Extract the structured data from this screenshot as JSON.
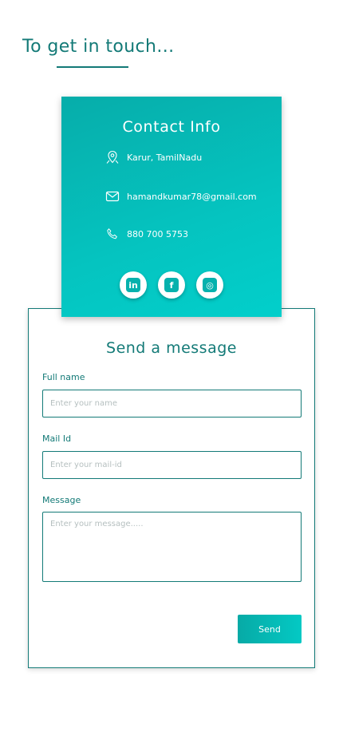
{
  "header": {
    "title": "To get in touch..."
  },
  "contact": {
    "title": "Contact Info",
    "location": "Karur, TamilNadu",
    "email": "hamandkumar78@gmail.com",
    "phone": "880 700 5753",
    "socials": [
      {
        "name": "linkedin",
        "glyph": "in"
      },
      {
        "name": "facebook",
        "glyph": "f"
      },
      {
        "name": "instagram",
        "glyph": "◎"
      }
    ]
  },
  "form": {
    "title": "Send a message",
    "name_label": "Full name",
    "name_placeholder": "Enter your name",
    "mail_label": "Mail Id",
    "mail_placeholder": "Enter your mail-id",
    "message_label": "Message",
    "message_placeholder": "Enter your message.....",
    "send_label": "Send"
  },
  "colors": {
    "accent": "#137a77",
    "card_gradient_start": "#06adaa",
    "card_gradient_end": "#02cfcb"
  }
}
